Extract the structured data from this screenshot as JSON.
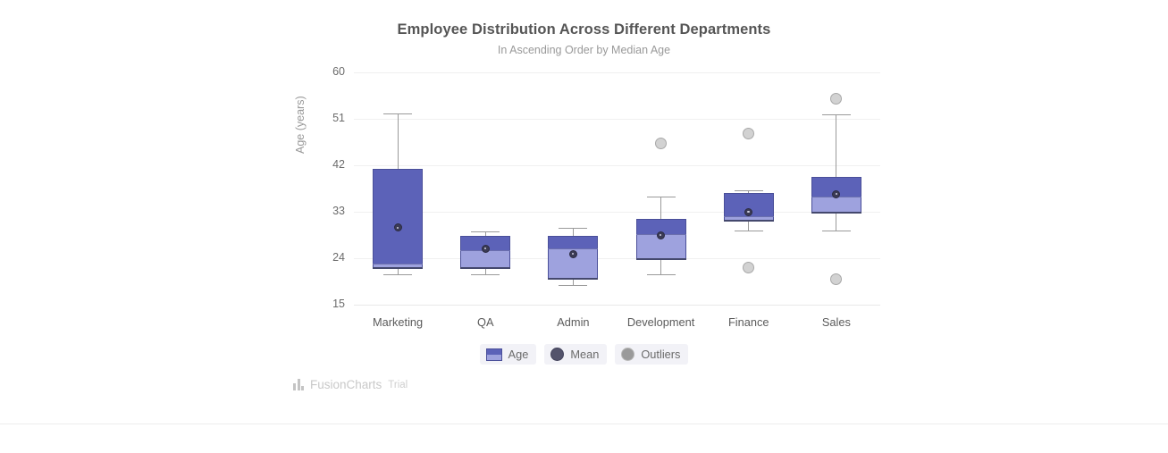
{
  "chart": {
    "title": "Employee Distribution Across Different Departments",
    "subtitle": "In Ascending Order by Median Age",
    "y_axis_title": "Age (years)"
  },
  "legend": {
    "items": [
      {
        "label": "Age",
        "swatch": "box-two-tone",
        "color_upper": "#5c62b8",
        "color_lower": "#9ea2de"
      },
      {
        "label": "Mean",
        "swatch": "circle-dark",
        "color": "#53536b"
      },
      {
        "label": "Outliers",
        "swatch": "circle-gray",
        "color": "#9a9a9a"
      }
    ]
  },
  "watermark": {
    "name": "FusionCharts",
    "edition": "Trial",
    "icon": "bar-chart-icon"
  },
  "chart_data": {
    "type": "box",
    "title": "Employee Distribution Across Different Departments",
    "subtitle": "In Ascending Order by Median Age",
    "xlabel": "",
    "ylabel": "Age (years)",
    "ylim": [
      15,
      60
    ],
    "yticks": [
      15,
      24,
      33,
      42,
      51,
      60
    ],
    "grid": true,
    "legend_position": "bottom",
    "categories": [
      "Marketing",
      "QA",
      "Admin",
      "Development",
      "Finance",
      "Sales"
    ],
    "series": [
      {
        "name": "Age",
        "boxes": [
          {
            "category": "Marketing",
            "min": 20.8,
            "q1": 22.1,
            "median": 22.9,
            "q3": 41.3,
            "max": 52.0,
            "mean": 29.9,
            "outliers": []
          },
          {
            "category": "QA",
            "min": 20.8,
            "q1": 22.1,
            "median": 25.6,
            "q3": 28.3,
            "max": 29.2,
            "mean": 25.8,
            "outliers": []
          },
          {
            "category": "Admin",
            "min": 18.8,
            "q1": 20.0,
            "median": 25.9,
            "q3": 28.3,
            "max": 29.8,
            "mean": 24.8,
            "outliers": []
          },
          {
            "category": "Development",
            "min": 20.9,
            "q1": 23.9,
            "median": 28.6,
            "q3": 31.6,
            "max": 36.0,
            "mean": 28.4,
            "outliers": [
              46.2
            ]
          },
          {
            "category": "Finance",
            "min": 29.3,
            "q1": 31.3,
            "median": 32.2,
            "q3": 36.6,
            "max": 37.2,
            "mean": 33.0,
            "outliers": [
              48.2,
              22.1
            ]
          },
          {
            "category": "Sales",
            "min": 29.3,
            "q1": 32.8,
            "median": 35.9,
            "q3": 39.7,
            "max": 51.8,
            "mean": 36.4,
            "outliers": [
              54.9,
              20.0
            ]
          }
        ]
      }
    ]
  }
}
